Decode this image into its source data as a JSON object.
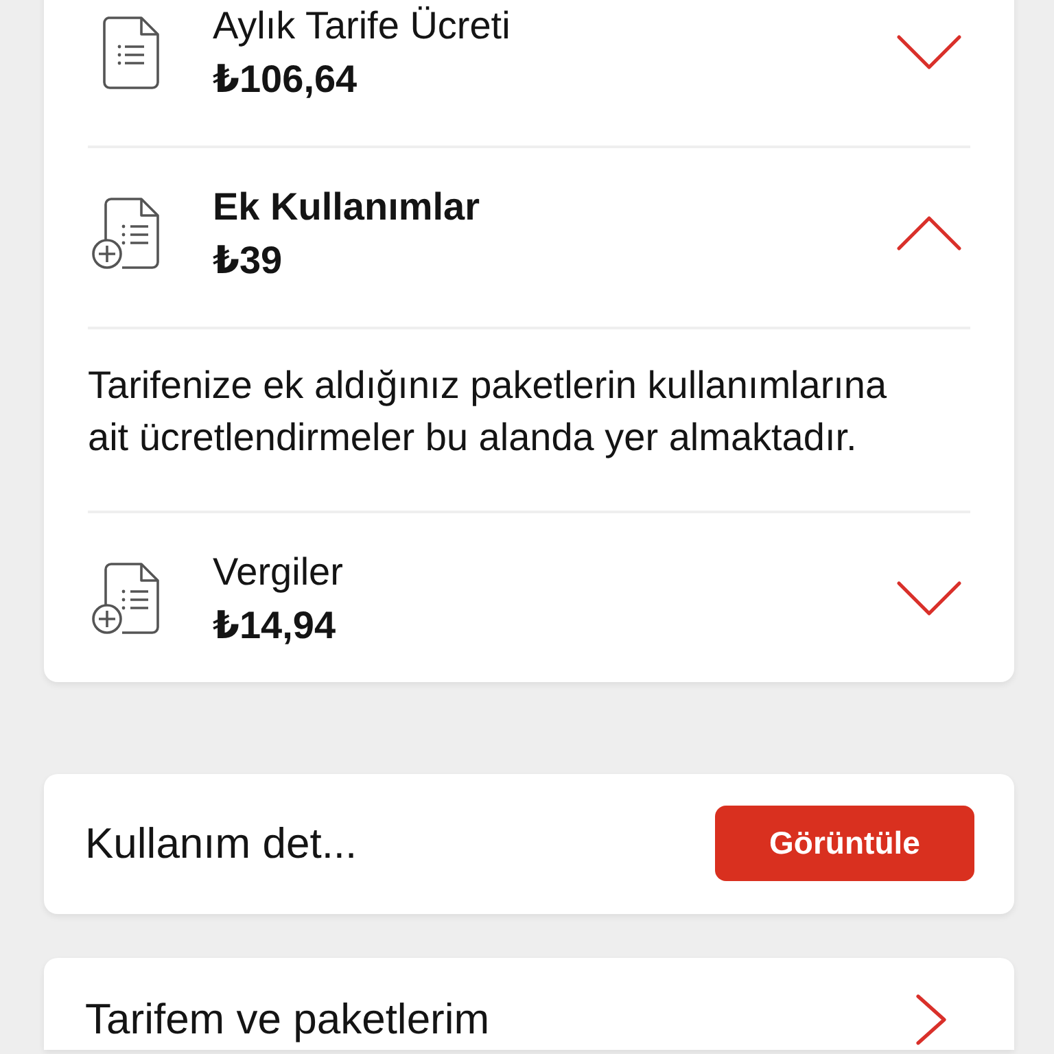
{
  "charges": [
    {
      "kind": "document",
      "title": "Aylık Tarife Ücreti",
      "amount": "₺106,64",
      "expanded": false
    },
    {
      "kind": "addition",
      "title": "Ek Kullanımlar",
      "amount": "₺39",
      "expanded": true,
      "description": "Tarifenize ek aldığınız paketlerin kullanımlarına ait ücretlendirmeler bu alanda yer almaktadır."
    },
    {
      "kind": "addition",
      "title": "Vergiler",
      "amount": "₺14,94",
      "expanded": false
    }
  ],
  "usage_details": {
    "label": "Kullanım det...",
    "button": "Görüntüle"
  },
  "tariff_link": {
    "label": "Tarifem ve paketlerim"
  }
}
